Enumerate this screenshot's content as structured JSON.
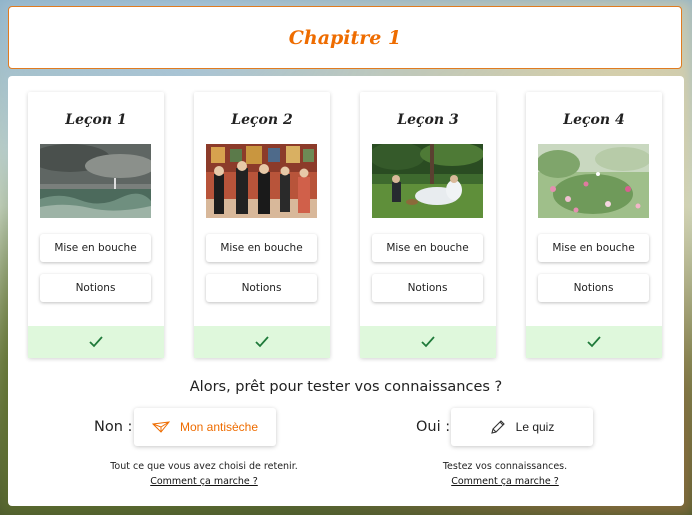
{
  "header": {
    "title": "Chapitre 1"
  },
  "lessons": [
    {
      "title": "Leçon 1",
      "btn1": "Mise en bouche",
      "btn2": "Notions"
    },
    {
      "title": "Leçon 2",
      "btn1": "Mise en bouche",
      "btn2": "Notions"
    },
    {
      "title": "Leçon 3",
      "btn1": "Mise en bouche",
      "btn2": "Notions"
    },
    {
      "title": "Leçon 4",
      "btn1": "Mise en bouche",
      "btn2": "Notions"
    }
  ],
  "quiz_section": {
    "question": "Alors, prêt pour tester vos connaissances ?",
    "no_label": "Non :",
    "cheatsheet_button": "Mon antisèche",
    "cheatsheet_desc": "Tout ce que vous avez choisi de retenir.",
    "cheatsheet_link": "Comment ça marche ?",
    "yes_label": "Oui :",
    "quiz_button": "Le quiz",
    "quiz_desc": "Testez vos connaissances.",
    "quiz_link": "Comment ça marche ?"
  },
  "colors": {
    "accent": "#ee6c00",
    "done_bg": "#dff8dc",
    "check": "#1f7a3a"
  },
  "icons": {
    "status": "check-icon",
    "cheatsheet": "paper-plane-icon",
    "quiz": "pencil-icon"
  }
}
